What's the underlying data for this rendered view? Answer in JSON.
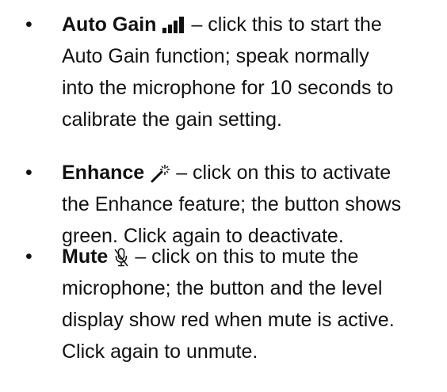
{
  "items": [
    {
      "title": "Auto Gain",
      "icon": "signal-bars-icon",
      "line1_rest": "– click this to start the",
      "line2": "Auto Gain function; speak normally",
      "line3": "into the microphone for 10 seconds to",
      "line4": "calibrate the gain setting."
    },
    {
      "title": "Enhance",
      "icon": "magic-wand-icon",
      "line1_rest": "– click on this to activate",
      "line2": "the Enhance feature; the button shows",
      "line3": "green. Click again to deactivate."
    },
    {
      "title": "Mute",
      "icon": "muted-microphone-icon",
      "line1_rest": "– click on this to mute the",
      "line2": "microphone; the button and the level",
      "line3": "display show red when mute is active.",
      "line4": "Click again to unmute."
    }
  ],
  "bullet": "•"
}
